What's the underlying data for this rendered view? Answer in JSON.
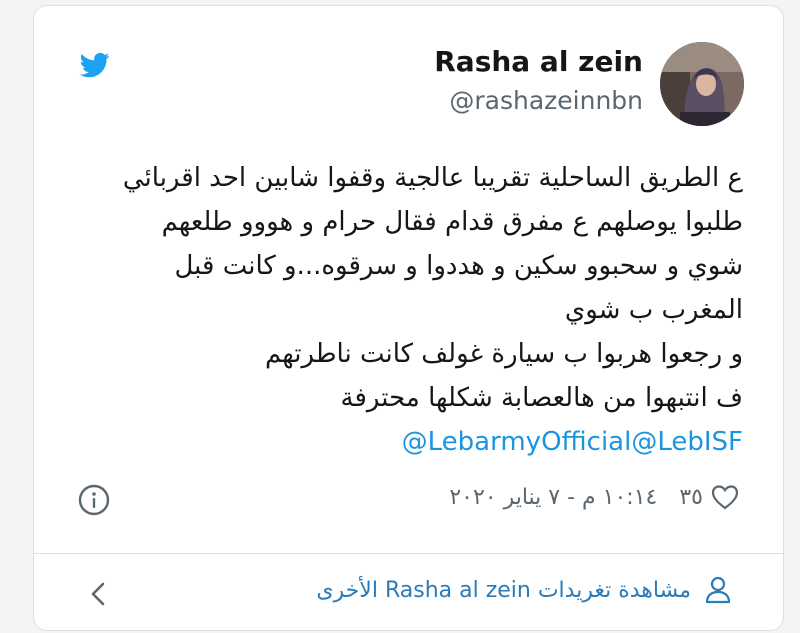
{
  "user": {
    "display_name": "Rasha al zein",
    "handle": "@rashazeinnbn"
  },
  "tweet": {
    "lines": [
      "ع الطريق الساحلية تقريبا عالجية وقفوا شابين احد اقربائي",
      "طلبوا يوصلهم ع مفرق قدام  فقال حرام و  هووو طلعهم",
      "شوي و سحبوو سكين  و هددوا و سرقوه...و كانت قبل",
      "المغرب ب شوي",
      "و رجعوا هربوا ب سيارة غولف كانت ناطرتهم",
      "ف انتبهوا من هالعصابة شكلها محترفة"
    ],
    "mentions": "@LebarmyOfficial@LebISF"
  },
  "meta": {
    "like_count": "٣٥",
    "timestamp": "١٠:١٤ م - ٧ يناير ٢٠٢٠"
  },
  "footer": {
    "view_more_label": "مشاهدة تغريدات Rasha al zein الأخرى"
  },
  "icons": {
    "brand": "twitter-bird-icon",
    "info": "info-icon",
    "like": "heart-icon",
    "profile": "person-icon",
    "nav": "chevron-left-icon"
  },
  "colors": {
    "brand_blue": "#1da1f2",
    "link_blue": "#1b95e0",
    "secondary_text": "#5b6770",
    "border": "#d9dfe3"
  }
}
